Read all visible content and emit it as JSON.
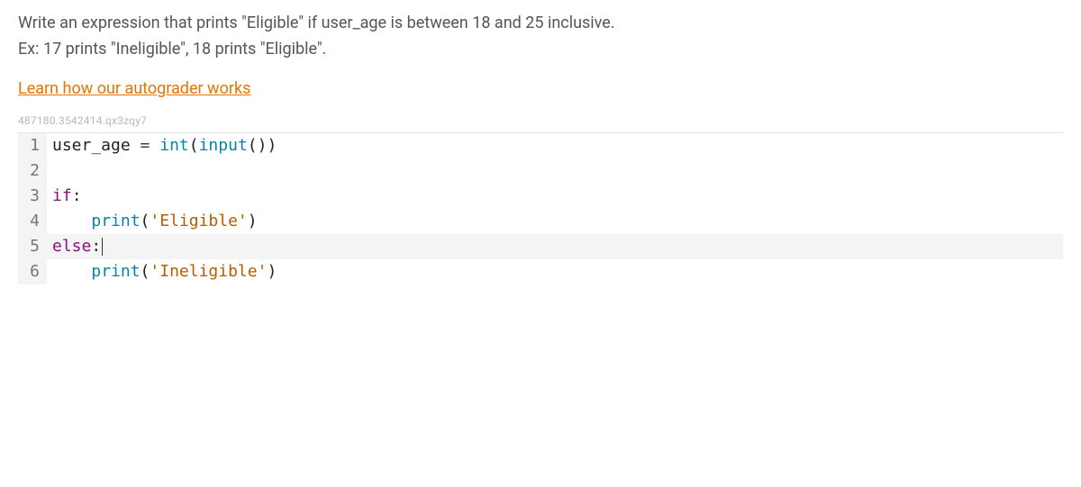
{
  "prompt": {
    "line1": "Write an expression that prints \"Eligible\" if user_age is between 18 and 25 inclusive.",
    "line2": "Ex: 17 prints \"Ineligible\", 18 prints \"Eligible\"."
  },
  "learn_link": "Learn how our autograder works",
  "question_id": "487180.3542414.qx3zqy7",
  "code": {
    "lines": [
      {
        "n": "1"
      },
      {
        "n": "2"
      },
      {
        "n": "3"
      },
      {
        "n": "4"
      },
      {
        "n": "5"
      },
      {
        "n": "6"
      }
    ],
    "line1": {
      "t1": "user_age ",
      "op": "=",
      "sp": " ",
      "fn1": "int",
      "p1": "(",
      "fn2": "input",
      "p2": "())"
    },
    "line2": "",
    "line3": {
      "kw": "if",
      "rest": ":"
    },
    "line4": {
      "indent": "    ",
      "fn": "print",
      "p1": "(",
      "str": "'Eligible'",
      "p2": ")"
    },
    "line5": {
      "kw": "else",
      "rest": ":"
    },
    "line6": {
      "indent": "    ",
      "fn": "print",
      "p1": "(",
      "str": "'Ineligible'",
      "p2": ")"
    }
  }
}
